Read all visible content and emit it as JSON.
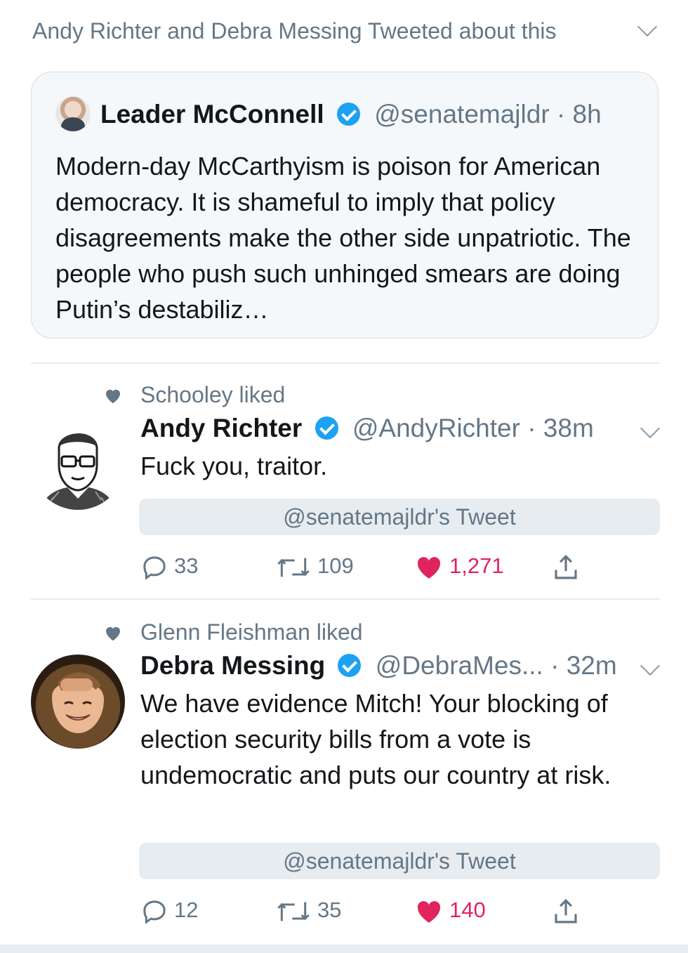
{
  "header": {
    "title": "Andy Richter and Debra Messing Tweeted about this"
  },
  "quoted_tweet": {
    "name": "Leader McConnell",
    "handle": "@senatemajldr",
    "time": "· 8h",
    "text": "Modern-day McCarthyism is poison for American democracy. It is shameful to imply that policy disagreements make the other side unpatriotic. The people who push such unhinged smears are doing Putin’s destabiliz…"
  },
  "tweets": [
    {
      "liked_by": "Schooley liked",
      "name": "Andy Richter",
      "handle": "@AndyRichter",
      "time": "· 38m",
      "text": "Fuck you, traitor.",
      "ref_label": "@senatemajldr's Tweet",
      "replies": "33",
      "retweets": "109",
      "likes": "1,271"
    },
    {
      "liked_by": "Glenn Fleishman liked",
      "name": "Debra Messing",
      "handle": "@DebraMes...",
      "time": "· 32m",
      "text": "We have evidence Mitch! Your blocking of election security bills from a vote is undemocratic and puts our country at risk.",
      "ref_label": "@senatemajldr's Tweet",
      "replies": "12",
      "retweets": "35",
      "likes": "140"
    }
  ],
  "colors": {
    "accent": "#1da1f2",
    "like": "#e0245e",
    "secondary_text": "#657786"
  },
  "icons": [
    "chevron-down-icon",
    "verified-badge-icon",
    "heart-icon",
    "reply-icon",
    "retweet-icon",
    "share-icon"
  ]
}
